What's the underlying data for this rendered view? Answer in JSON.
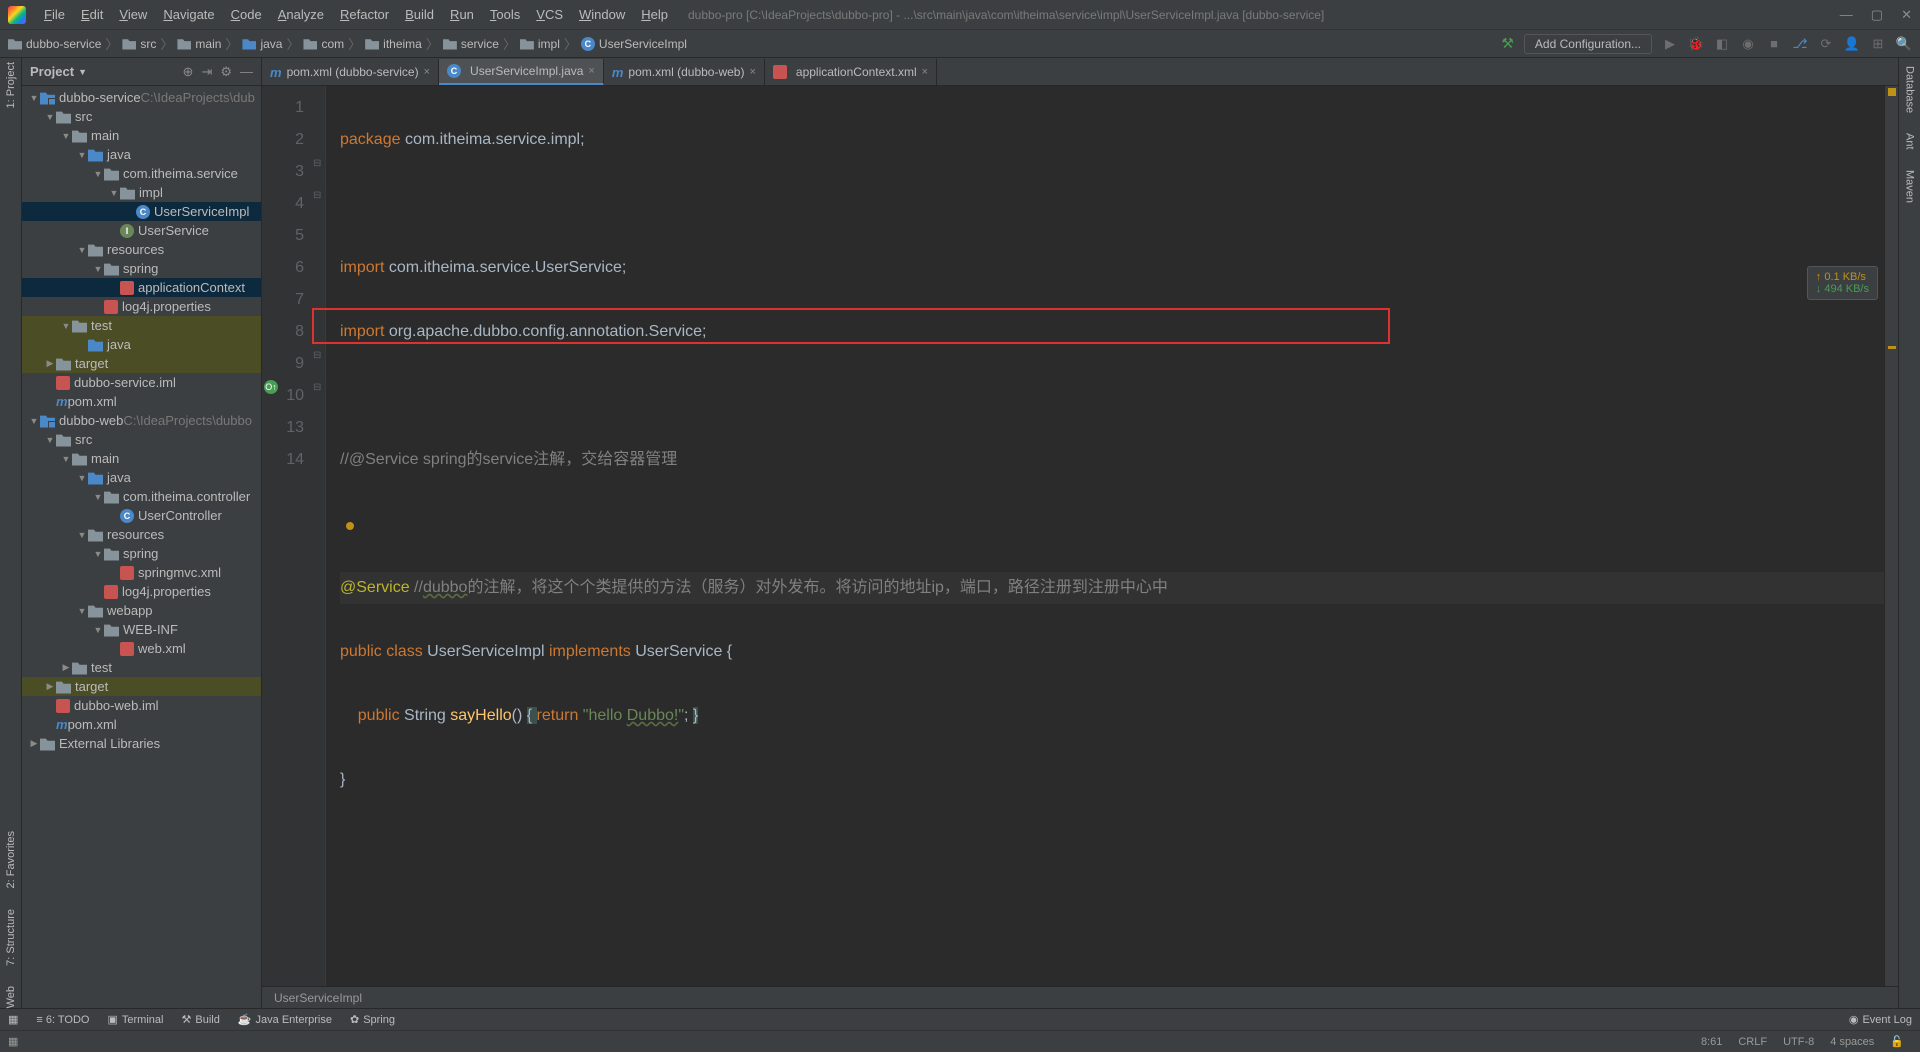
{
  "menu": [
    "File",
    "Edit",
    "View",
    "Navigate",
    "Code",
    "Analyze",
    "Refactor",
    "Build",
    "Run",
    "Tools",
    "VCS",
    "Window",
    "Help"
  ],
  "title_path": "dubbo-pro [C:\\IdeaProjects\\dubbo-pro] - ...\\src\\main\\java\\com\\itheima\\service\\impl\\UserServiceImpl.java [dubbo-service]",
  "breadcrumb": [
    "dubbo-service",
    "src",
    "main",
    "java",
    "com",
    "itheima",
    "service",
    "impl",
    "UserServiceImpl"
  ],
  "add_config": "Add Configuration...",
  "project": {
    "label": "Project",
    "tree": [
      {
        "d": 0,
        "tw": "▼",
        "ico": "mod",
        "txt": "dubbo-service",
        "dim": "C:\\IdeaProjects\\dub"
      },
      {
        "d": 1,
        "tw": "▼",
        "ico": "fld",
        "txt": "src"
      },
      {
        "d": 2,
        "tw": "▼",
        "ico": "fld",
        "txt": "main"
      },
      {
        "d": 3,
        "tw": "▼",
        "ico": "fb",
        "txt": "java"
      },
      {
        "d": 4,
        "tw": "▼",
        "ico": "fld",
        "txt": "com.itheima.service"
      },
      {
        "d": 5,
        "tw": "▼",
        "ico": "fld",
        "txt": "impl"
      },
      {
        "d": 6,
        "tw": "",
        "ico": "cls",
        "txt": "UserServiceImpl",
        "sel": true
      },
      {
        "d": 5,
        "tw": "",
        "ico": "ifc",
        "txt": "UserService"
      },
      {
        "d": 3,
        "tw": "▼",
        "ico": "fld",
        "txt": "resources"
      },
      {
        "d": 4,
        "tw": "▼",
        "ico": "fld",
        "txt": "spring"
      },
      {
        "d": 5,
        "tw": "",
        "ico": "xml",
        "txt": "applicationContext",
        "sel": true
      },
      {
        "d": 4,
        "tw": "",
        "ico": "xml",
        "txt": "log4j.properties"
      },
      {
        "d": 2,
        "tw": "▼",
        "ico": "fld",
        "txt": "test",
        "hl": true
      },
      {
        "d": 3,
        "tw": "",
        "ico": "fb",
        "txt": "java",
        "hl": true
      },
      {
        "d": 1,
        "tw": "▶",
        "ico": "fld",
        "txt": "target",
        "hl": true
      },
      {
        "d": 1,
        "tw": "",
        "ico": "xml",
        "txt": "dubbo-service.iml"
      },
      {
        "d": 1,
        "tw": "",
        "ico": "m",
        "txt": "pom.xml"
      },
      {
        "d": 0,
        "tw": "▼",
        "ico": "mod",
        "txt": "dubbo-web",
        "dim": "C:\\IdeaProjects\\dubbo"
      },
      {
        "d": 1,
        "tw": "▼",
        "ico": "fld",
        "txt": "src"
      },
      {
        "d": 2,
        "tw": "▼",
        "ico": "fld",
        "txt": "main"
      },
      {
        "d": 3,
        "tw": "▼",
        "ico": "fb",
        "txt": "java"
      },
      {
        "d": 4,
        "tw": "▼",
        "ico": "fld",
        "txt": "com.itheima.controller"
      },
      {
        "d": 5,
        "tw": "",
        "ico": "cls",
        "txt": "UserController"
      },
      {
        "d": 3,
        "tw": "▼",
        "ico": "fld",
        "txt": "resources"
      },
      {
        "d": 4,
        "tw": "▼",
        "ico": "fld",
        "txt": "spring"
      },
      {
        "d": 5,
        "tw": "",
        "ico": "xml",
        "txt": "springmvc.xml"
      },
      {
        "d": 4,
        "tw": "",
        "ico": "xml",
        "txt": "log4j.properties"
      },
      {
        "d": 3,
        "tw": "▼",
        "ico": "fld",
        "txt": "webapp"
      },
      {
        "d": 4,
        "tw": "▼",
        "ico": "fld",
        "txt": "WEB-INF"
      },
      {
        "d": 5,
        "tw": "",
        "ico": "xml",
        "txt": "web.xml"
      },
      {
        "d": 2,
        "tw": "▶",
        "ico": "fld",
        "txt": "test"
      },
      {
        "d": 1,
        "tw": "▶",
        "ico": "fld",
        "txt": "target",
        "hl": true
      },
      {
        "d": 1,
        "tw": "",
        "ico": "xml",
        "txt": "dubbo-web.iml"
      },
      {
        "d": 1,
        "tw": "",
        "ico": "m",
        "txt": "pom.xml"
      },
      {
        "d": 0,
        "tw": "▶",
        "ico": "lib",
        "txt": "External Libraries"
      }
    ]
  },
  "tabs": [
    {
      "ico": "m",
      "label": "pom.xml (dubbo-service)"
    },
    {
      "ico": "cls",
      "label": "UserServiceImpl.java",
      "active": true
    },
    {
      "ico": "m",
      "label": "pom.xml (dubbo-web)"
    },
    {
      "ico": "xml",
      "label": "applicationContext.xml"
    }
  ],
  "code": {
    "lines": [
      "1",
      "2",
      "3",
      "4",
      "5",
      "6",
      "7",
      "8",
      "9",
      "10",
      "13",
      "14"
    ],
    "l1": {
      "kw": "package",
      "rest": " com.itheima.service.impl;"
    },
    "l3": {
      "kw": "import",
      "rest": " com.itheima.service.UserService;"
    },
    "l4": {
      "kw": "import",
      "rest1": " org.apache.dubbo.config.annotation.",
      "cls": "Service",
      "rest2": ";"
    },
    "l6": "//@Service spring的service注解，交给容器管理",
    "l8": {
      "ann": "@Service",
      "cm": " //",
      "wavy": "dubbo",
      "cm2": "的注解，将这个个类提供的方法（服务）对外发布。将访问的地址ip，端口，路径注册到注册中心中"
    },
    "l9": {
      "a": "public class ",
      "b": "UserServiceImpl ",
      "c": "implements ",
      "d": "UserService ",
      "e": "{"
    },
    "l10": {
      "a": "    public ",
      "b": "String ",
      "fn": "sayHello",
      "c": "() ",
      "d": "{ ",
      "e": "return ",
      "str": "\"hello ",
      "wavy": "Dubbo!",
      "str2": "\"",
      "f": "; ",
      "g": "}"
    },
    "l13": "}"
  },
  "crumb_trail": "UserServiceImpl",
  "net": {
    "up": "↑ 0.1 KB/s",
    "dn": "↓ 494 KB/s"
  },
  "left_gutter": [
    "1: Project"
  ],
  "left_gutter2": [
    "2: Favorites",
    "7: Structure",
    "Web"
  ],
  "right_gutter": [
    "Database",
    "Ant",
    "Maven"
  ],
  "bottom_tools": [
    "≡ 6: TODO",
    "Terminal",
    "Build",
    "Java Enterprise",
    "Spring"
  ],
  "event_log": "Event Log",
  "status": {
    "pos": "8:61",
    "le": "CRLF",
    "enc": "UTF-8",
    "indent": "4 spaces"
  }
}
